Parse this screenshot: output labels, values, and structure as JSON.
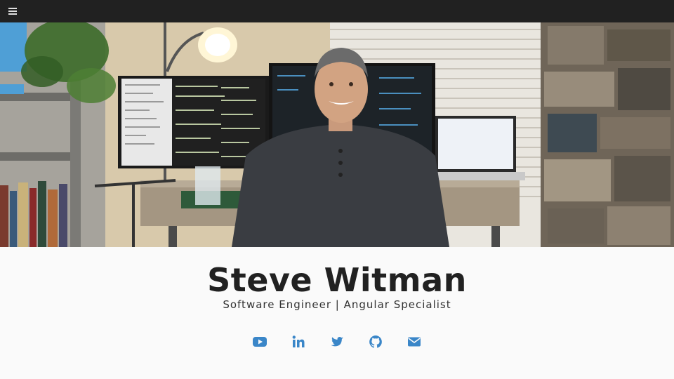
{
  "header": {
    "menu_icon": "hamburger-menu-icon"
  },
  "hero": {
    "description_icon": "portrait-photo"
  },
  "profile": {
    "name": "Steve Witman",
    "tagline": "Software Engineer | Angular Specialist"
  },
  "social": [
    {
      "icon": "youtube-icon"
    },
    {
      "icon": "linkedin-icon"
    },
    {
      "icon": "twitter-icon"
    },
    {
      "icon": "github-icon"
    },
    {
      "icon": "email-icon"
    }
  ],
  "colors": {
    "topbar": "#212121",
    "accent": "#3a86c8",
    "text": "#212121",
    "background": "#fafafa"
  }
}
